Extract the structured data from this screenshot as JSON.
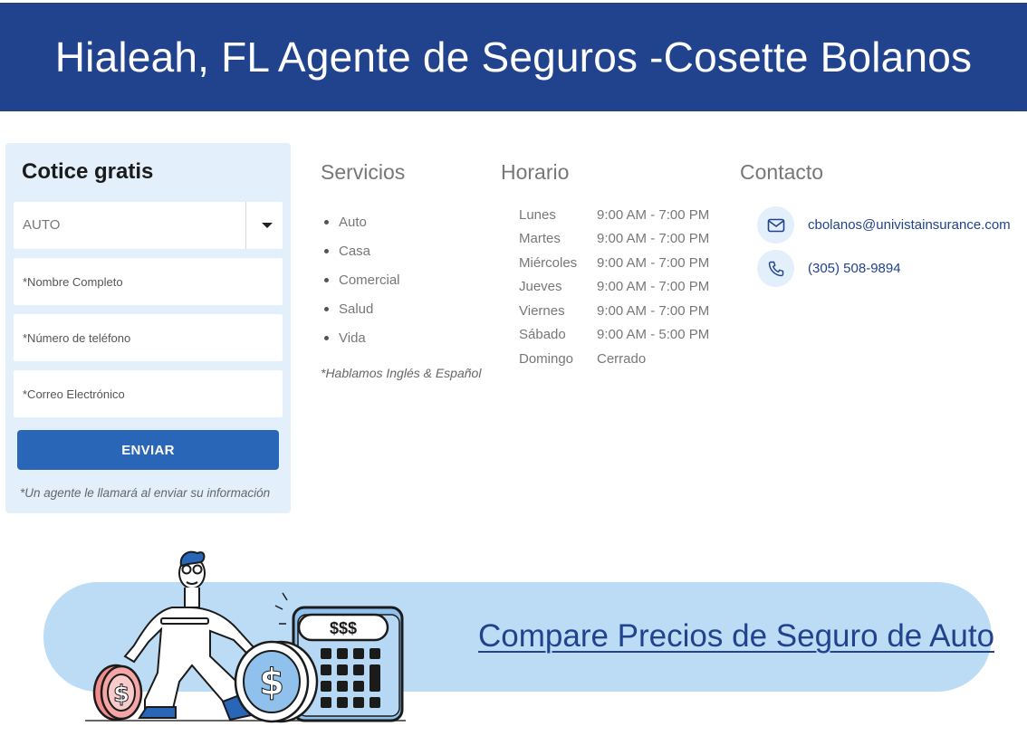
{
  "header": {
    "title": "Hialeah, FL Agente de Seguros -Cosette Bolanos"
  },
  "quote_form": {
    "title": "Cotice gratis",
    "product_select": {
      "value": "AUTO"
    },
    "fields": [
      {
        "placeholder": "*Nombre Completo"
      },
      {
        "placeholder": "*Número de teléfono"
      },
      {
        "placeholder": "*Correo Electrónico"
      }
    ],
    "submit_label": "ENVIAR",
    "note": "*Un agente le llamará al enviar su información"
  },
  "services": {
    "title": "Servicios",
    "items": [
      "Auto",
      "Casa",
      "Comercial",
      "Salud",
      "Vida"
    ],
    "note": "*Hablamos Inglés & Español"
  },
  "hours": {
    "title": "Horario",
    "rows": [
      {
        "day": "Lunes",
        "time": "9:00 AM - 7:00 PM"
      },
      {
        "day": "Martes",
        "time": "9:00 AM - 7:00 PM"
      },
      {
        "day": "Miércoles",
        "time": "9:00 AM - 7:00 PM"
      },
      {
        "day": "Jueves",
        "time": "9:00 AM - 7:00 PM"
      },
      {
        "day": "Viernes",
        "time": "9:00 AM - 7:00 PM"
      },
      {
        "day": "Sábado",
        "time": "9:00 AM - 5:00 PM"
      },
      {
        "day": "Domingo",
        "time": "Cerrado"
      }
    ]
  },
  "contact": {
    "title": "Contacto",
    "email": "cbolanos@univistainsurance.com",
    "phone": "(305) 508-9894",
    "email_icon": "envelope-icon",
    "phone_icon": "phone-icon"
  },
  "banner": {
    "link_text": "Compare Precios de Seguro de Auto",
    "calculator_display": "$$$",
    "coin_symbol": "$"
  },
  "colors": {
    "header_bg": "#21438e",
    "button": "#2a66b8",
    "form_bg": "#e3effa",
    "banner_bg": "#bcdcf5",
    "link": "#21438e"
  }
}
